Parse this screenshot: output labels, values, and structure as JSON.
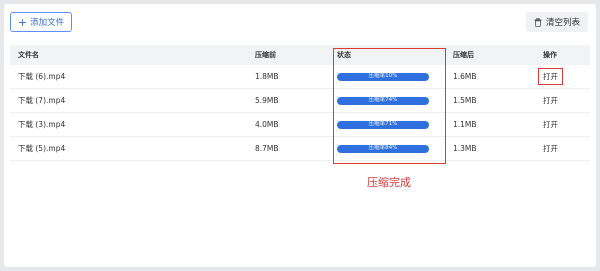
{
  "toolbar": {
    "add_label": "添加文件",
    "clear_label": "清空列表"
  },
  "table": {
    "headers": {
      "name": "文件名",
      "before": "压缩前",
      "status": "状态",
      "after": "压缩后",
      "op": "操作"
    },
    "rows": [
      {
        "name": "下载 (6).mp4",
        "before": "1.8MB",
        "status": "压缩率10%",
        "progress": 1.0,
        "after": "1.6MB",
        "op": "打开"
      },
      {
        "name": "下载 (7).mp4",
        "before": "5.9MB",
        "status": "压缩率74%",
        "progress": 1.0,
        "after": "1.5MB",
        "op": "打开"
      },
      {
        "name": "下载 (3).mp4",
        "before": "4.0MB",
        "status": "压缩率71%",
        "progress": 1.0,
        "after": "1.1MB",
        "op": "打开"
      },
      {
        "name": "下载 (5).mp4",
        "before": "8.7MB",
        "status": "压缩率84%",
        "progress": 1.0,
        "after": "1.3MB",
        "op": "打开"
      }
    ]
  },
  "annotation": {
    "text": "压缩完成"
  },
  "colors": {
    "accent": "#2f6fe0",
    "highlight": "#d93a3a",
    "header_bg": "#f2f3f5"
  }
}
